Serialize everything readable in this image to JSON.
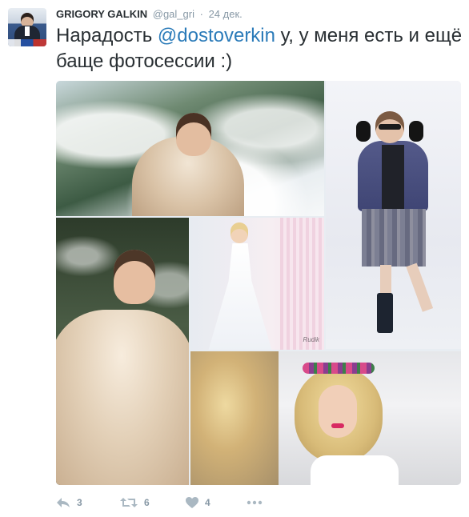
{
  "author": {
    "name": "GRIGORY GALKIN",
    "handle": "@gal_gri",
    "separator": "·",
    "date": "24 дек."
  },
  "tweet": {
    "text_before": "Нарадость ",
    "mention": "@dostoverkin",
    "text_after": " у, у меня есть и ещё баще фотосессии :)"
  },
  "media": {
    "watermark": "Rudik"
  },
  "actions": {
    "reply_count": "3",
    "retweet_count": "6",
    "like_count": "4",
    "reply_icon": "reply-icon",
    "retweet_icon": "retweet-icon",
    "like_icon": "heart-icon",
    "more_icon": "more-icon"
  },
  "colors": {
    "text": "#292f33",
    "secondary": "#8899a6",
    "link": "#2b7bb9"
  }
}
